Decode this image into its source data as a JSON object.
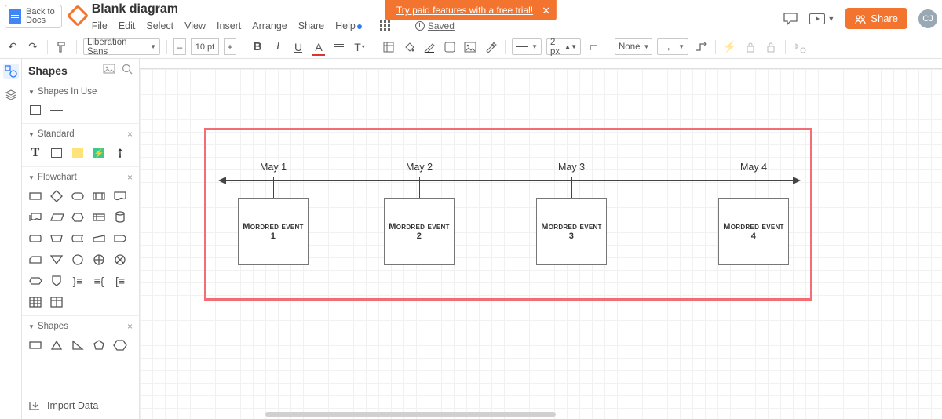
{
  "back_to_docs": "Back to\nDocs",
  "doc_title": "Blank diagram",
  "menu": {
    "file": "File",
    "edit": "Edit",
    "select": "Select",
    "view": "View",
    "insert": "Insert",
    "arrange": "Arrange",
    "share": "Share",
    "help": "Help"
  },
  "saved_label": "Saved",
  "trial_text": "Try paid features with a free trial!",
  "share_btn": "Share",
  "avatar": "CJ",
  "toolbar": {
    "font": "Liberation Sans",
    "size": "10 pt",
    "border_w": "2 px",
    "fill": "None"
  },
  "panel": {
    "title": "Shapes",
    "sec_inuse": "Shapes In Use",
    "sec_standard": "Standard",
    "sec_flow": "Flowchart",
    "sec_shapes": "Shapes",
    "import": "Import Data"
  },
  "timeline": {
    "dates": [
      "May 1",
      "May 2",
      "May 3",
      "May 4"
    ],
    "events": [
      "Mordred event 1",
      "Mordred event 2",
      "Mordred event 3",
      "Mordred event 4"
    ]
  }
}
